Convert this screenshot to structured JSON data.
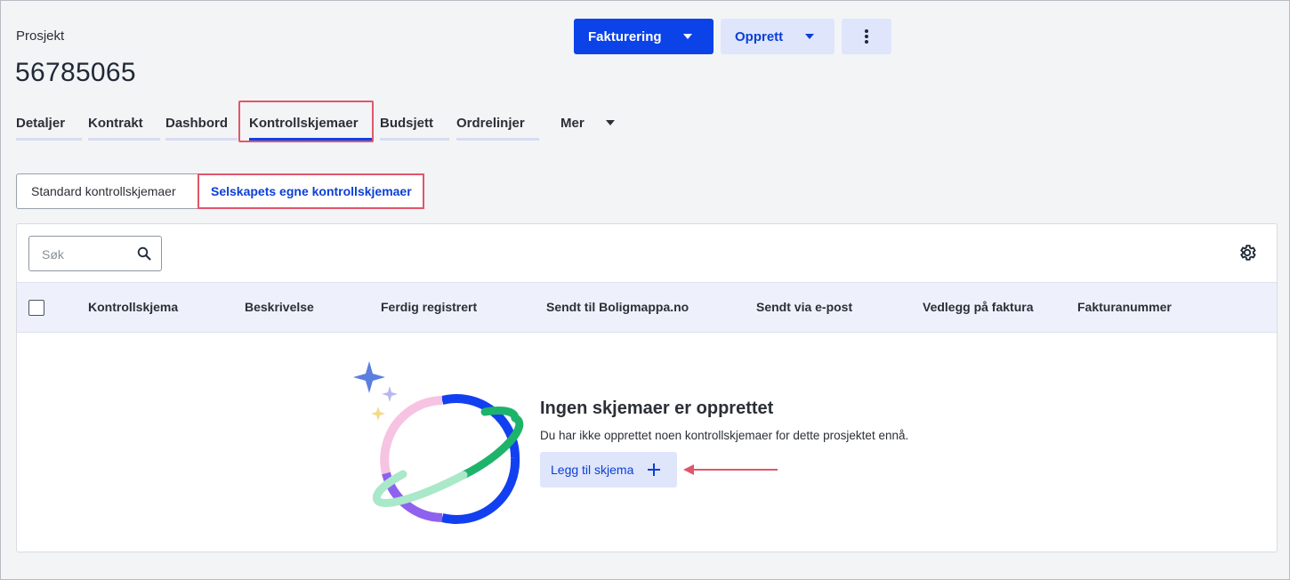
{
  "header": {
    "breadcrumb": "Prosjekt",
    "project_number": "56785065"
  },
  "actions": {
    "invoice_label": "Fakturering",
    "create_label": "Opprett",
    "more_icon": "vertical-dots-icon"
  },
  "tabs": [
    {
      "label": "Detaljer"
    },
    {
      "label": "Kontrakt"
    },
    {
      "label": "Dashbord"
    },
    {
      "label": "Kontrollskjemaer",
      "active": true
    },
    {
      "label": "Budsjett"
    },
    {
      "label": "Ordrelinjer"
    },
    {
      "label": "Mer"
    }
  ],
  "segments": {
    "standard": "Standard kontrollskjemaer",
    "own": "Selskapets egne kontrollskjemaer"
  },
  "search": {
    "placeholder": "Søk",
    "value": ""
  },
  "table": {
    "columns": [
      "Kontrollskjema",
      "Beskrivelse",
      "Ferdig registrert",
      "Sendt til Boligmappa.no",
      "Sendt via e-post",
      "Vedlegg på faktura",
      "Fakturanummer"
    ],
    "rows": []
  },
  "empty_state": {
    "title": "Ingen skjemaer er opprettet",
    "description": "Du har ikke opprettet noen kontrollskjemaer for dette prosjektet ennå.",
    "button_label": "Legg til skjema"
  },
  "colors": {
    "primary": "#0b43e8",
    "secondary_bg": "#dfe5fb",
    "highlight": "#e0566a"
  }
}
